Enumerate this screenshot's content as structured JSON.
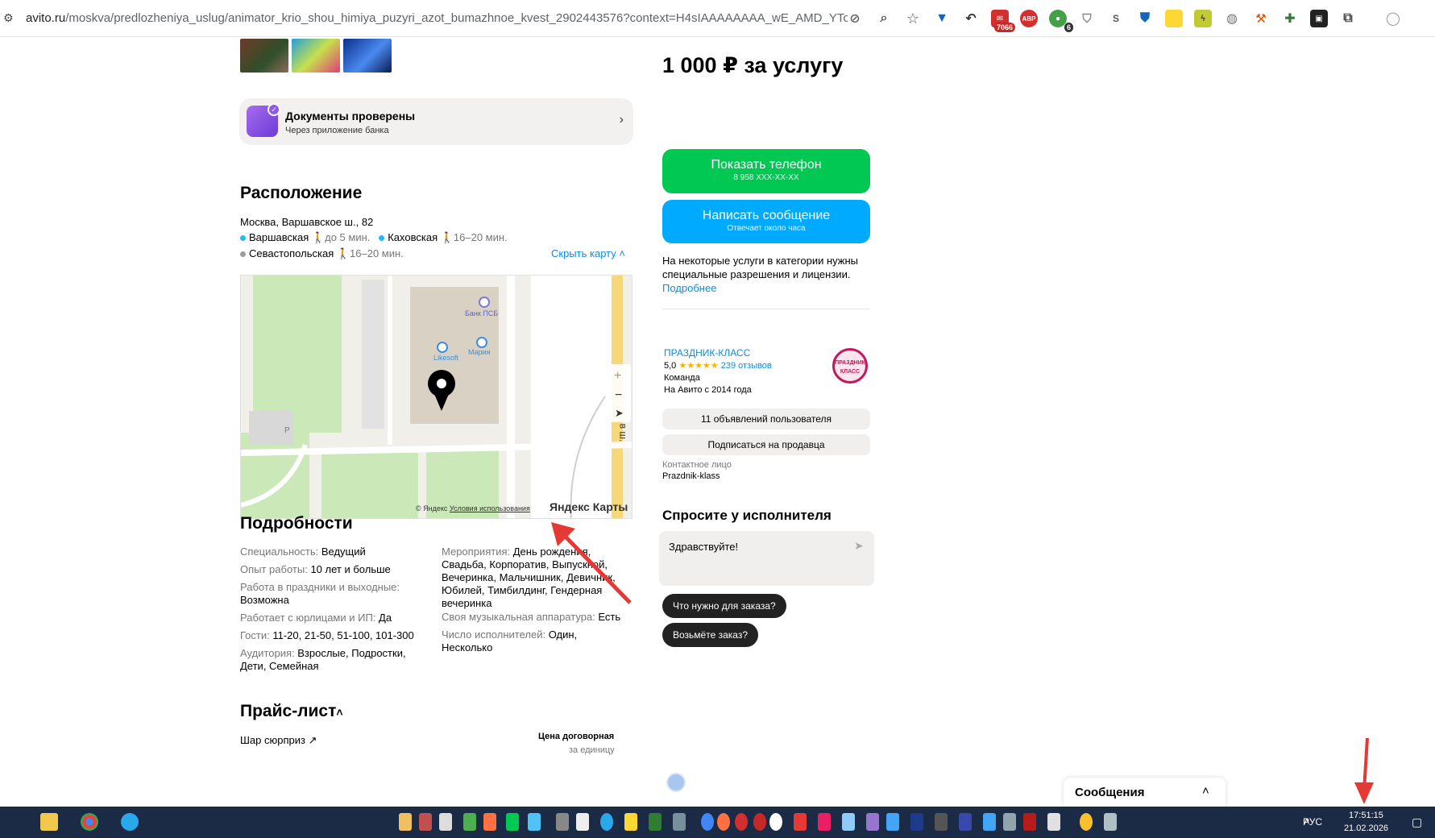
{
  "browser": {
    "url_host": "avito.ru",
    "url_path": "/moskva/predlozheniya_uslug/animator_krio_shou_himiya_puzyri_azot_bumazhnoe_kvest_2902443576?context=H4sIAAAAAAAA_wE_AMD_YToyOntzOjEzO...",
    "badge_mail": "7066",
    "badge_abp": "ABP",
    "badge_ext": "6"
  },
  "docs": {
    "title": "Документы проверены",
    "subtitle": "Через приложение банка",
    "chevron": "›"
  },
  "location": {
    "heading": "Расположение",
    "address": "Москва, Варшавское ш., 82",
    "metro": [
      {
        "name": "Варшавская",
        "time": "до 5 мин.",
        "color": "#29b6f6"
      },
      {
        "name": "Каховская",
        "time": "16–20 мин.",
        "color": "#29b6f6"
      },
      {
        "name": "Севастопольская",
        "time": "16–20 мин.",
        "color": "#9e9e9e"
      }
    ],
    "hide_map": "Скрыть карту",
    "map_labels": {
      "bank": "Банк ПСБ",
      "likesoft": "Likesoft",
      "maria": "Мария",
      "copyright": "© Яндекс",
      "terms": "Условия использования",
      "brand": "Яндекс Карты",
      "road": "в ш.",
      "parking": "P",
      "zoom_in": "+",
      "zoom_out": "−"
    }
  },
  "details": {
    "heading": "Подробности",
    "left": [
      {
        "label": "Специальность:",
        "value": "Ведущий"
      },
      {
        "label": "Опыт работы:",
        "value": "10 лет и больше"
      },
      {
        "label": "Работа в праздники и выходные:",
        "value": "Возможна"
      },
      {
        "label": "Работает с юрлицами и ИП:",
        "value": "Да"
      },
      {
        "label": "Гости:",
        "value": "11-20, 21-50, 51-100, 101-300"
      },
      {
        "label": "Аудитория:",
        "value": "Взрослые, Подростки, Дети, Семейная"
      }
    ],
    "right": [
      {
        "label": "Мероприятия:",
        "value": "День рождения, Свадьба, Корпоратив, Выпускной, Вечеринка, Мальчишник, Девичник, Юбилей, Тимбилдинг, Гендерная вечеринка"
      },
      {
        "label": "Своя музыкальная аппаратура:",
        "value": "Есть"
      },
      {
        "label": "Число исполнителей:",
        "value": "Один, Несколько"
      }
    ]
  },
  "pricelist": {
    "heading": "Прайс-лист",
    "item": "Шар сюрприз",
    "price": "Цена договорная",
    "unit": "за единицу"
  },
  "sidebar": {
    "price": "1 000 ₽ за услугу",
    "phone_btn": "Показать телефон",
    "phone_sub": "8 958 XXX-XX-XX",
    "msg_btn": "Написать сообщение",
    "msg_sub": "Отвечает около часа",
    "notice": [
      "На некоторые услуги в категории нужны",
      "специальные разрешения и лицензии."
    ],
    "notice_link": "Подробнее",
    "seller_name": "ПРАЗДНИК-КЛАСС",
    "rating": "5,0",
    "stars": "★★★★★",
    "reviews": "239 отзывов",
    "seller_type": "Команда",
    "since": "На Авито с 2014 года",
    "stamp_text": "ПРАЗДНИК КЛАСС",
    "ads_btn": "11 объявлений пользователя",
    "subscribe_btn": "Подписаться на продавца",
    "contact_label": "Контактное лицо",
    "contact_name": "Prazdnik-klass"
  },
  "ask": {
    "heading": "Спросите у исполнителя",
    "input_value": "Здравствуйте!",
    "chips": [
      "Что нужно для заказа?",
      "Возьмёте заказ?"
    ]
  },
  "messages": {
    "label": "Сообщения"
  },
  "taskbar": {
    "lang": "РУС",
    "time": "17:51:15",
    "date": "21.02.2026"
  }
}
